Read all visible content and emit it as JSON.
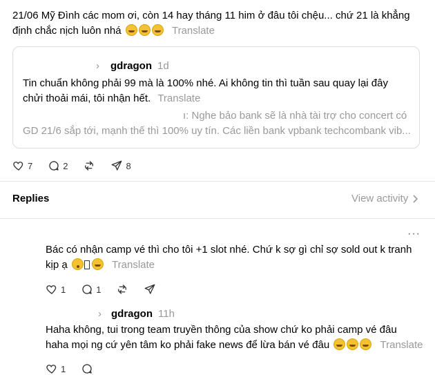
{
  "post": {
    "text_line1": "21/06 Mỹ Đình các mom ơi, còn 14 hay tháng 11 him ở đâu tôi chệu... chứ 21 là khẳng",
    "text_line2": "định chắc nịch luôn nhá",
    "translate": "Translate",
    "quote": {
      "arrow": "›",
      "username": "gdragon",
      "time": "1d",
      "line1": "Tin chuẩn không phải 99 mà là 100% nhé. Ai không tin thì tuần sau quay lại đây",
      "line2": "chửi thoải mái, tôi nhận hết.",
      "translate": "Translate",
      "faded_line1": "ı: Nghe bảo bank sẽ là nhà tài trợ cho concert có",
      "faded_line2": "GD 21/6 sắp tới, mạnh thế thì 100% uy tín. Các liền bank vpbank techcombank vib..."
    },
    "actions": {
      "likes": "7",
      "comments": "2",
      "shares": "8"
    }
  },
  "replies_header": {
    "title": "Replies",
    "view_activity": "View activity"
  },
  "replies": [
    {
      "more": "···",
      "line1": "Bác có nhận camp vé thì cho tôi +1 slot nhé. Chứ k sợ gì chỉ sợ sold out k tranh",
      "line2": "kịp ạ",
      "translate": "Translate",
      "actions": {
        "likes": "1",
        "comments": "1"
      }
    },
    {
      "arrow": "›",
      "username": "gdragon",
      "time": "11h",
      "line1": "Haha không, tui trong team truyền thông của show chứ ko phải camp vé đâu",
      "line2": "haha mọi ng cứ yên tâm ko phải fake news để lừa bán vé đâu",
      "translate": "Translate",
      "actions": {
        "likes": "1"
      }
    }
  ]
}
